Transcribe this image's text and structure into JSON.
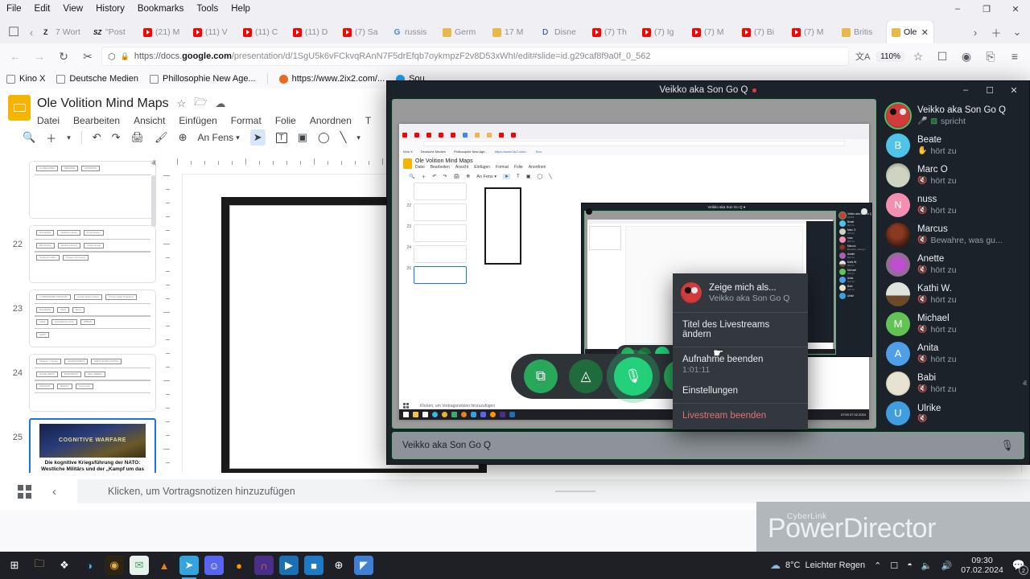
{
  "browser": {
    "menubar": [
      "File",
      "Edit",
      "View",
      "History",
      "Bookmarks",
      "Tools",
      "Help"
    ],
    "window_controls": {
      "minimize": "–",
      "maximize": "❐",
      "close": "✕"
    },
    "tabs": [
      {
        "label": "7 Wort",
        "favicon": "z-icon"
      },
      {
        "label": "\"Post",
        "favicon": "sz-icon"
      },
      {
        "label": "(21) M",
        "favicon": "youtube-icon"
      },
      {
        "label": "(11) V",
        "favicon": "youtube-icon"
      },
      {
        "label": "(11) C",
        "favicon": "youtube-icon"
      },
      {
        "label": "(11) D",
        "favicon": "youtube-icon"
      },
      {
        "label": "(7) Sa",
        "favicon": "youtube-icon"
      },
      {
        "label": "russis",
        "favicon": "google-icon"
      },
      {
        "label": "Germ",
        "favicon": "folder-icon"
      },
      {
        "label": "17 M",
        "favicon": "folder-icon"
      },
      {
        "label": "Disne",
        "favicon": "disney-icon"
      },
      {
        "label": "(7) Th",
        "favicon": "youtube-icon"
      },
      {
        "label": "(7) Ig",
        "favicon": "youtube-icon"
      },
      {
        "label": "(7) M",
        "favicon": "youtube-icon"
      },
      {
        "label": "(7) Bi",
        "favicon": "youtube-icon"
      },
      {
        "label": "(7) M",
        "favicon": "youtube-icon"
      },
      {
        "label": "Britis",
        "favicon": "folder-icon"
      },
      {
        "label": "Ole",
        "favicon": "folder-icon",
        "active": true,
        "close": "✕"
      }
    ],
    "tabstrip_right": {
      "list_all": "⌄",
      "scroll_right": "›",
      "new_tab": "＋",
      "dropdown": "⌄"
    },
    "nav": {
      "back": "←",
      "forward": "→",
      "reload": "↻",
      "pocket": "✂"
    },
    "url": {
      "scheme": "https://docs.",
      "domain": "google.com",
      "path": "/presentation/d/1SgU5k6vFCkvqRAnN7F5drEfqb7oykmpzF2v8D53xWhI/edit#slide=id.g29caf8f9a0f_0_562",
      "shield_icon": "⬡",
      "lock_icon": "🔒"
    },
    "toolbar_right": {
      "translate": "文A",
      "zoom": "110%",
      "bookmark_star": "☆",
      "reader": "☐",
      "account": "◉",
      "extensions": "⎘",
      "menu": "≡"
    },
    "bookmarks": [
      {
        "label": "Kino X",
        "icon": "folder-icon"
      },
      {
        "label": "Deutsche Medien",
        "icon": "folder-icon"
      },
      {
        "label": "Phillosophie New Age...",
        "icon": "folder-icon"
      },
      {
        "label": "https://www.2ix2.com/...",
        "icon": "link-icon"
      },
      {
        "label": "Sou",
        "icon": "link-icon"
      }
    ]
  },
  "slides": {
    "title": "Ole Volition Mind Maps",
    "title_icons": {
      "star": "☆",
      "move": "🗁",
      "cloud": "☁"
    },
    "menu": [
      "Datei",
      "Bearbeiten",
      "Ansicht",
      "Einfügen",
      "Format",
      "Folie",
      "Anordnen",
      "T"
    ],
    "toolbar": {
      "search": "🔍",
      "add": "＋",
      "add_caret": "▾",
      "undo": "↶",
      "redo": "↷",
      "print": "🖨",
      "paint": "🖌",
      "zoom_in": "⊕",
      "zoom_label": "An Fens",
      "zoom_caret": "▾",
      "cursor": "➤",
      "textbox": "T",
      "image": "▣",
      "shape": "◯",
      "line": "╲",
      "line_caret": "▾"
    },
    "thumbnails": [
      {
        "number": "",
        "kind": "partial",
        "labels": [
          "GLOBALISTEN",
          "BERATER",
          "EXPERTEN"
        ]
      },
      {
        "number": "22",
        "kind": "mindmap",
        "labels": [
          "Roundtable",
          "Chatham House",
          "Royal Society",
          "Bild Zeitung",
          "Frankfurt School",
          "Institut Sozial",
          "Tavistock Institut",
          "Pioneer Community"
        ]
      },
      {
        "number": "23",
        "kind": "mindmap",
        "labels": [
          "2. PROGRAMM STIFTUNG",
          "London School of Eco",
          "Young Leader Programm",
          "Roundtable",
          "NGO",
          "Soros",
          "Cabal",
          "Europäische Union",
          "FABIAN",
          "SAINT"
        ]
      },
      {
        "number": "24",
        "kind": "mindmap",
        "labels": [
          "Fabianer = Society",
          "ANARCHISMUS",
          "WESTLICHES KAPITAL",
          "SOZIALISMUS",
          "MARXISMUS",
          "NEO LIBERAL",
          "FASCHIST",
          "ZIONIST",
          "Kommunist"
        ]
      },
      {
        "number": "25",
        "kind": "cover",
        "selected": true,
        "image_caption": "COGNITIVE WARFARE",
        "text": "Die kognitive Kriegsführung der NATO: Westliche Militärs und der „Kampf um das Gehirn“"
      }
    ],
    "filmstrip_scroll": {
      "up": "ⱏ",
      "down": "ⱟ"
    },
    "bottom": {
      "grid_icon": "grid-view-icon",
      "collapse": "‹",
      "notes_placeholder": "Klicken, um Vortragsnotizen hinzuzufügen"
    }
  },
  "call": {
    "window_title": "Veikko aka Son Go Q",
    "recording_dot": true,
    "window_controls": {
      "minimize": "–",
      "maximize": "☐",
      "close": "✕"
    },
    "self_label": "Veikko aka Son Go Q",
    "self_mic_icon": "🎙",
    "controls": [
      {
        "name": "screen-share",
        "icon": "⧉",
        "style": "green"
      },
      {
        "name": "camera-off",
        "icon": "◬",
        "style": "dimgreen"
      },
      {
        "name": "microphone",
        "icon": "🎙",
        "style": "mic"
      },
      {
        "name": "more-options",
        "icon": "•••",
        "style": "green"
      },
      {
        "name": "hang-up",
        "icon": "✆",
        "style": "red"
      }
    ],
    "participants": [
      {
        "name": "Veikko aka Son Go Q",
        "status": "spricht",
        "state": "speaking",
        "avatar": "av-veikko",
        "initial": ""
      },
      {
        "name": "Beate",
        "status": "hört zu",
        "state": "hand",
        "avatar": "av-beate",
        "initial": "B"
      },
      {
        "name": "Marc O",
        "status": "hört zu",
        "state": "muted",
        "avatar": "av-marco",
        "initial": ""
      },
      {
        "name": "nuss",
        "status": "hört zu",
        "state": "muted",
        "avatar": "av-nuss",
        "initial": "N"
      },
      {
        "name": "Marcus",
        "status": "Bewahre, was gu...",
        "state": "muted",
        "avatar": "av-marcus",
        "initial": ""
      },
      {
        "name": "Anette",
        "status": "hört zu",
        "state": "muted",
        "avatar": "av-anette",
        "initial": ""
      },
      {
        "name": "Kathi W.",
        "status": "hört zu",
        "state": "muted",
        "avatar": "av-kathi",
        "initial": ""
      },
      {
        "name": "Michael",
        "status": "hört zu",
        "state": "muted",
        "avatar": "av-michael",
        "initial": "M"
      },
      {
        "name": "Anita",
        "status": "hört zu",
        "state": "muted",
        "avatar": "av-anita",
        "initial": "A"
      },
      {
        "name": "Babi",
        "status": "hört zu",
        "state": "muted",
        "avatar": "av-babi",
        "initial": ""
      },
      {
        "name": "Ulrike",
        "status": "",
        "state": "muted",
        "avatar": "av-ulrike",
        "initial": "U"
      }
    ],
    "roster_scroll": {
      "up": "ⱏ",
      "down": "ⱟ"
    }
  },
  "context_menu": {
    "user_title": "Zeige mich als...",
    "user_name": "Veikko aka Son Go Q",
    "items": [
      {
        "label": "Titel des Livestreams ändern",
        "sub": ""
      },
      {
        "label": "Aufnahme beenden",
        "sub": "1:01:11"
      },
      {
        "label": "Einstellungen",
        "sub": ""
      },
      {
        "label": "Livestream beenden",
        "sub": "",
        "danger": true
      }
    ]
  },
  "watermark": {
    "brand": "CyberLink",
    "product": "PowerDirector"
  },
  "taskbar": {
    "apps": [
      {
        "name": "start-button",
        "icon": "⊞",
        "color": "#ffffff",
        "bg": "transparent"
      },
      {
        "name": "file-explorer",
        "icon": "🗀",
        "color": "#f3c04a",
        "bg": "transparent"
      },
      {
        "name": "dropbox",
        "icon": "❖",
        "color": "#ffffff",
        "bg": "transparent"
      },
      {
        "name": "microsoft-edge",
        "icon": "◑",
        "color": "#3fb6e0",
        "bg": "transparent"
      },
      {
        "name": "audio-app",
        "icon": "◉",
        "color": "#e8b23a",
        "bg": "#2d2416"
      },
      {
        "name": "mail-app",
        "icon": "✉",
        "color": "#3fa86a",
        "bg": "#e7f3ea"
      },
      {
        "name": "vlc-media-player",
        "icon": "▲",
        "color": "#e8821e",
        "bg": "transparent"
      },
      {
        "name": "telegram",
        "icon": "➤",
        "color": "#ffffff",
        "bg": "#33a4dd",
        "active": true
      },
      {
        "name": "discord",
        "icon": "☺",
        "color": "#ffffff",
        "bg": "#5865f2"
      },
      {
        "name": "firefox",
        "icon": "●",
        "color": "#ff9500",
        "bg": "transparent"
      },
      {
        "name": "headphones-app",
        "icon": "∩",
        "color": "#ff6a3d",
        "bg": "#4a2f8a"
      },
      {
        "name": "media-player",
        "icon": "▶",
        "color": "#ffffff",
        "bg": "#1a6fb5"
      },
      {
        "name": "store",
        "icon": "■",
        "color": "#ffffff",
        "bg": "#1e7ac4"
      },
      {
        "name": "utorrent",
        "icon": "⊕",
        "color": "#ffffff",
        "bg": "transparent"
      },
      {
        "name": "photo-editor",
        "icon": "◤",
        "color": "#ffffff",
        "bg": "#3f7fd4"
      }
    ],
    "tray": {
      "weather_temp": "8°C",
      "weather_desc": "Leichter Regen",
      "chevron": "⌃",
      "icons": [
        "⊞",
        "📶",
        "🎙",
        "🔊"
      ],
      "time": "09:30",
      "date": "07.02.2024",
      "notification_count": "2"
    }
  }
}
